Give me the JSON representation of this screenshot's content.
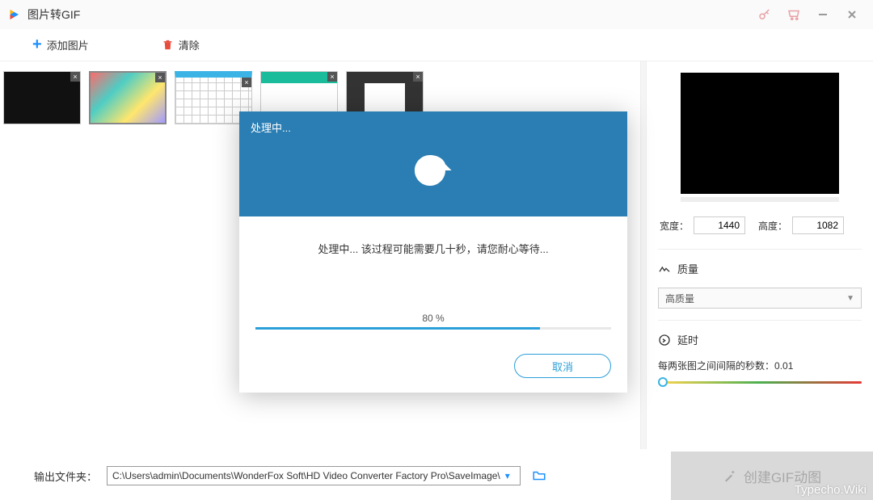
{
  "title": "图片转GIF",
  "toolbar": {
    "add_label": "添加图片",
    "clear_label": "清除"
  },
  "right": {
    "width_label": "宽度：",
    "width_value": "1440",
    "height_label": "高度：",
    "height_value": "1082",
    "quality_label": "质量",
    "quality_selected": "高质量",
    "delay_label": "延时",
    "delay_desc": "每两张图之间间隔的秒数：",
    "delay_value": "0.01"
  },
  "bottom": {
    "output_label": "输出文件夹：",
    "output_path": "C:\\Users\\admin\\Documents\\WonderFox Soft\\HD Video Converter Factory Pro\\SaveImage\\",
    "create_label": "创建GIF动图"
  },
  "dialog": {
    "title": "处理中...",
    "message": "处理中... 该过程可能需要几十秒，请您耐心等待...",
    "percent_text": "80 %",
    "percent": 80,
    "cancel_label": "取消"
  },
  "watermark": "Typecho.Wiki"
}
